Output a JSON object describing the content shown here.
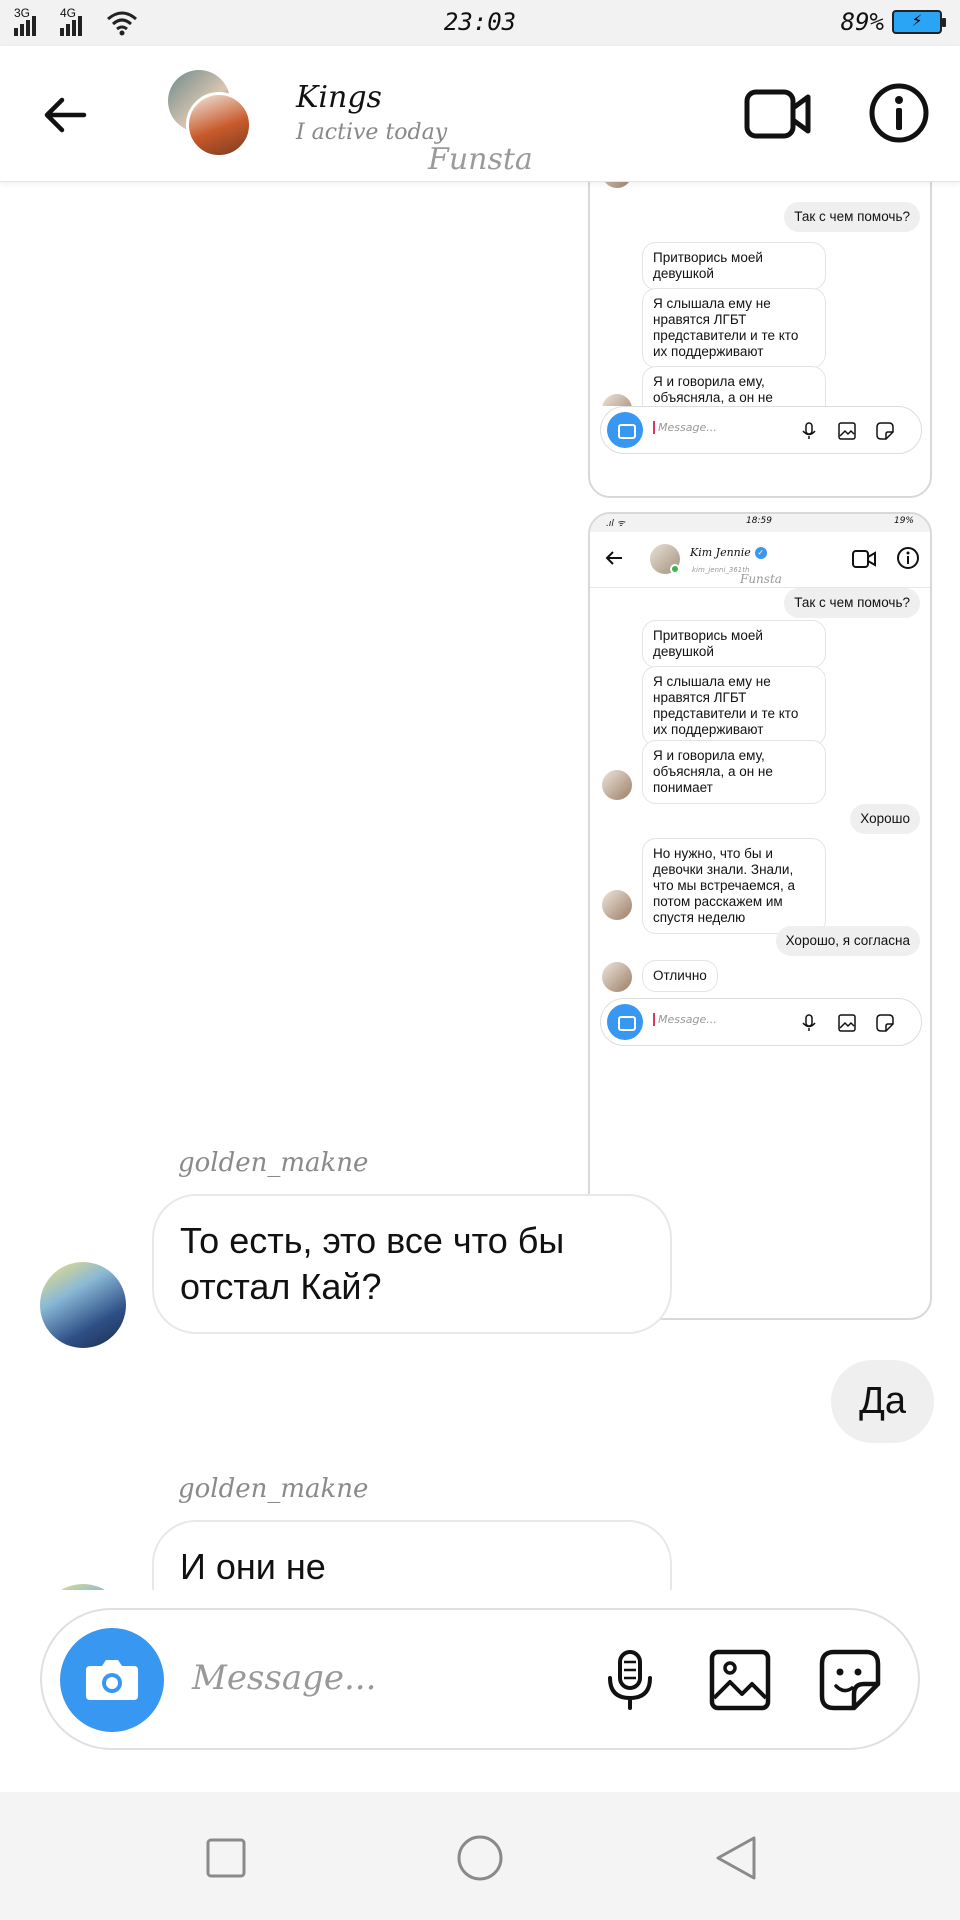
{
  "status_bar": {
    "network1": "3G",
    "network2": "4G",
    "time": "23:03",
    "battery_percent": "89%",
    "battery_level": 0.89
  },
  "header": {
    "title": "Kings",
    "subtitle": "I active today",
    "watermark": "Funsta"
  },
  "embedded_shot_1": {
    "messages": [
      {
        "side": "out",
        "text": "Так с чем помочь?"
      },
      {
        "side": "in",
        "text": "Притворись моей девушкой"
      },
      {
        "side": "in",
        "text": "Я слышала ему не нравятся ЛГБТ представители и те кто их поддерживают"
      },
      {
        "side": "in",
        "text": "Я и говорила ему, объясняла, а он не понимает"
      }
    ],
    "placeholder": "Message..."
  },
  "embedded_shot_2": {
    "status_time": "18:59",
    "status_battery": "19%",
    "contact_name": "Kim Jennie",
    "contact_username": "kim_jenni_361th",
    "watermark": "Funsta",
    "messages": [
      {
        "side": "out",
        "text": "Так с чем помочь?"
      },
      {
        "side": "in",
        "text": "Притворись моей девушкой"
      },
      {
        "side": "in",
        "text": "Я слышала ему не нравятся ЛГБТ представители и те кто их поддерживают"
      },
      {
        "side": "in",
        "text": "Я и говорила ему, объясняла, а он не понимает"
      },
      {
        "side": "out",
        "text": "Хорошо"
      },
      {
        "side": "in",
        "text": "Но нужно, что бы и девочки знали. Знали, что мы встречаемся, а потом расскажем им спустя неделю"
      },
      {
        "side": "out",
        "text": "Хорошо, я согласна"
      },
      {
        "side": "in",
        "text": "Отлично"
      }
    ],
    "placeholder": "Message..."
  },
  "messages": [
    {
      "sender": "golden_makne",
      "text": "То есть, это все что бы отстал Кай?"
    },
    {
      "side": "out",
      "text": "Да"
    },
    {
      "sender": "golden_makne",
      "text": "И они не"
    }
  ],
  "composer": {
    "placeholder": "Message..."
  },
  "colors": {
    "accent": "#3897f0",
    "outgoing_bubble": "#efefef"
  },
  "icons": {
    "header": [
      "back-arrow-icon",
      "video-camera-icon",
      "info-icon"
    ],
    "composer": [
      "camera-icon",
      "microphone-icon",
      "gallery-icon",
      "sticker-icon"
    ],
    "navbar": [
      "recents-square-icon",
      "home-circle-icon",
      "back-triangle-icon"
    ]
  }
}
